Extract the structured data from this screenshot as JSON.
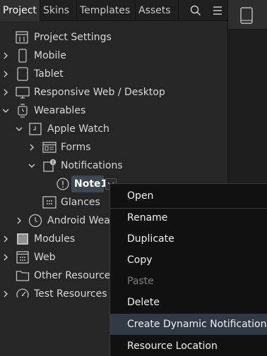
{
  "tabs": [
    {
      "label": "Project",
      "active": true
    },
    {
      "label": "Skins",
      "active": false
    },
    {
      "label": "Templates",
      "active": false
    },
    {
      "label": "Assets",
      "active": false
    }
  ],
  "toolbar_icons": [
    "search-icon",
    "menu-icon"
  ],
  "tree": {
    "project_settings": "Project Settings",
    "mobile": "Mobile",
    "tablet": "Tablet",
    "responsive": "Responsive Web / Desktop",
    "wearables": "Wearables",
    "apple_watch": "Apple Watch",
    "forms": "Forms",
    "notifications": "Notifications",
    "note1": "Note1",
    "glances": "Glances",
    "android_wear": "Android Wear",
    "modules": "Modules",
    "web": "Web",
    "other_resources": "Other Resources",
    "test_resources": "Test Resources"
  },
  "context_menu": {
    "open": "Open",
    "rename": "Rename",
    "duplicate": "Duplicate",
    "copy": "Copy",
    "paste": "Paste",
    "delete": "Delete",
    "create_dynamic_notification": "Create Dynamic Notification",
    "resource_location": "Resource Location"
  },
  "colors": {
    "background": "#262626",
    "selection": "#3d4852",
    "menu_background": "#111111",
    "menu_hover": "#2f3a44",
    "text": "#d8d8d8",
    "disabled_text": "#7c7c7c"
  }
}
